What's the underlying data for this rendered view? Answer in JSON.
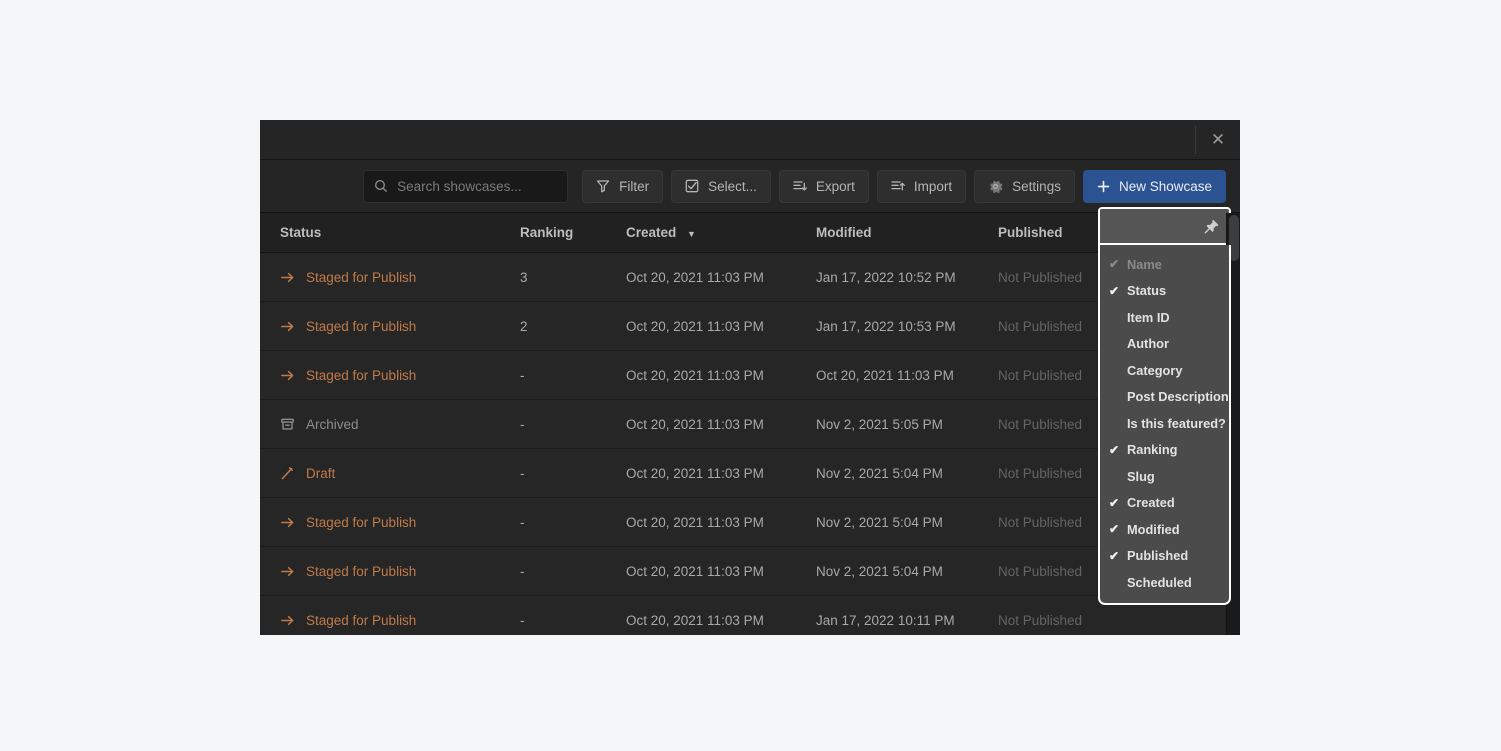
{
  "window": {
    "close_label": "✕"
  },
  "toolbar": {
    "search": {
      "placeholder": "Search showcases..."
    },
    "filter_label": "Filter",
    "select_label": "Select...",
    "export_label": "Export",
    "import_label": "Import",
    "settings_label": "Settings",
    "new_label": "New Showcase",
    "accent_blue": "#2b5291"
  },
  "table": {
    "columns": {
      "status": "Status",
      "ranking": "Ranking",
      "created": "Created",
      "modified": "Modified",
      "published": "Published"
    },
    "sort": {
      "column": "Created",
      "caret": "▼"
    },
    "status_color": "#c07a4a",
    "rows": [
      {
        "icon": "arrow-right-icon",
        "status": "Staged for Publish",
        "ranking": "3",
        "created": "Oct 20, 2021 11:03 PM",
        "modified": "Jan 17, 2022 10:52 PM",
        "published": "Not Published"
      },
      {
        "icon": "arrow-right-icon",
        "status": "Staged for Publish",
        "ranking": "2",
        "created": "Oct 20, 2021 11:03 PM",
        "modified": "Jan 17, 2022 10:53 PM",
        "published": "Not Published"
      },
      {
        "icon": "arrow-right-icon",
        "status": "Staged for Publish",
        "ranking": "-",
        "created": "Oct 20, 2021 11:03 PM",
        "modified": "Oct 20, 2021 11:03 PM",
        "published": "Not Published"
      },
      {
        "icon": "archive-icon",
        "status": "Archived",
        "ranking": "-",
        "created": "Oct 20, 2021 11:03 PM",
        "modified": "Nov 2, 2021 5:05 PM",
        "published": "Not Published"
      },
      {
        "icon": "pencil-icon",
        "status": "Draft",
        "ranking": "-",
        "created": "Oct 20, 2021 11:03 PM",
        "modified": "Nov 2, 2021 5:04 PM",
        "published": "Not Published"
      },
      {
        "icon": "arrow-right-icon",
        "status": "Staged for Publish",
        "ranking": "-",
        "created": "Oct 20, 2021 11:03 PM",
        "modified": "Nov 2, 2021 5:04 PM",
        "published": "Not Published"
      },
      {
        "icon": "arrow-right-icon",
        "status": "Staged for Publish",
        "ranking": "-",
        "created": "Oct 20, 2021 11:03 PM",
        "modified": "Nov 2, 2021 5:04 PM",
        "published": "Not Published"
      },
      {
        "icon": "arrow-right-icon",
        "status": "Staged for Publish",
        "ranking": "-",
        "created": "Oct 20, 2021 11:03 PM",
        "modified": "Jan 17, 2022 10:11 PM",
        "published": "Not Published"
      }
    ]
  },
  "column_menu": {
    "pin_icon": "pin-icon",
    "items": [
      {
        "label": "Name",
        "checked": true,
        "disabled": true
      },
      {
        "label": "Status",
        "checked": true,
        "disabled": false
      },
      {
        "label": "Item ID",
        "checked": false,
        "disabled": false
      },
      {
        "label": "Author",
        "checked": false,
        "disabled": false
      },
      {
        "label": "Category",
        "checked": false,
        "disabled": false
      },
      {
        "label": "Post Description",
        "checked": false,
        "disabled": false
      },
      {
        "label": "Is this featured?",
        "checked": false,
        "disabled": false
      },
      {
        "label": "Ranking",
        "checked": true,
        "disabled": false
      },
      {
        "label": "Slug",
        "checked": false,
        "disabled": false
      },
      {
        "label": "Created",
        "checked": true,
        "disabled": false
      },
      {
        "label": "Modified",
        "checked": true,
        "disabled": false
      },
      {
        "label": "Published",
        "checked": true,
        "disabled": false
      },
      {
        "label": "Scheduled",
        "checked": false,
        "disabled": false
      }
    ]
  }
}
